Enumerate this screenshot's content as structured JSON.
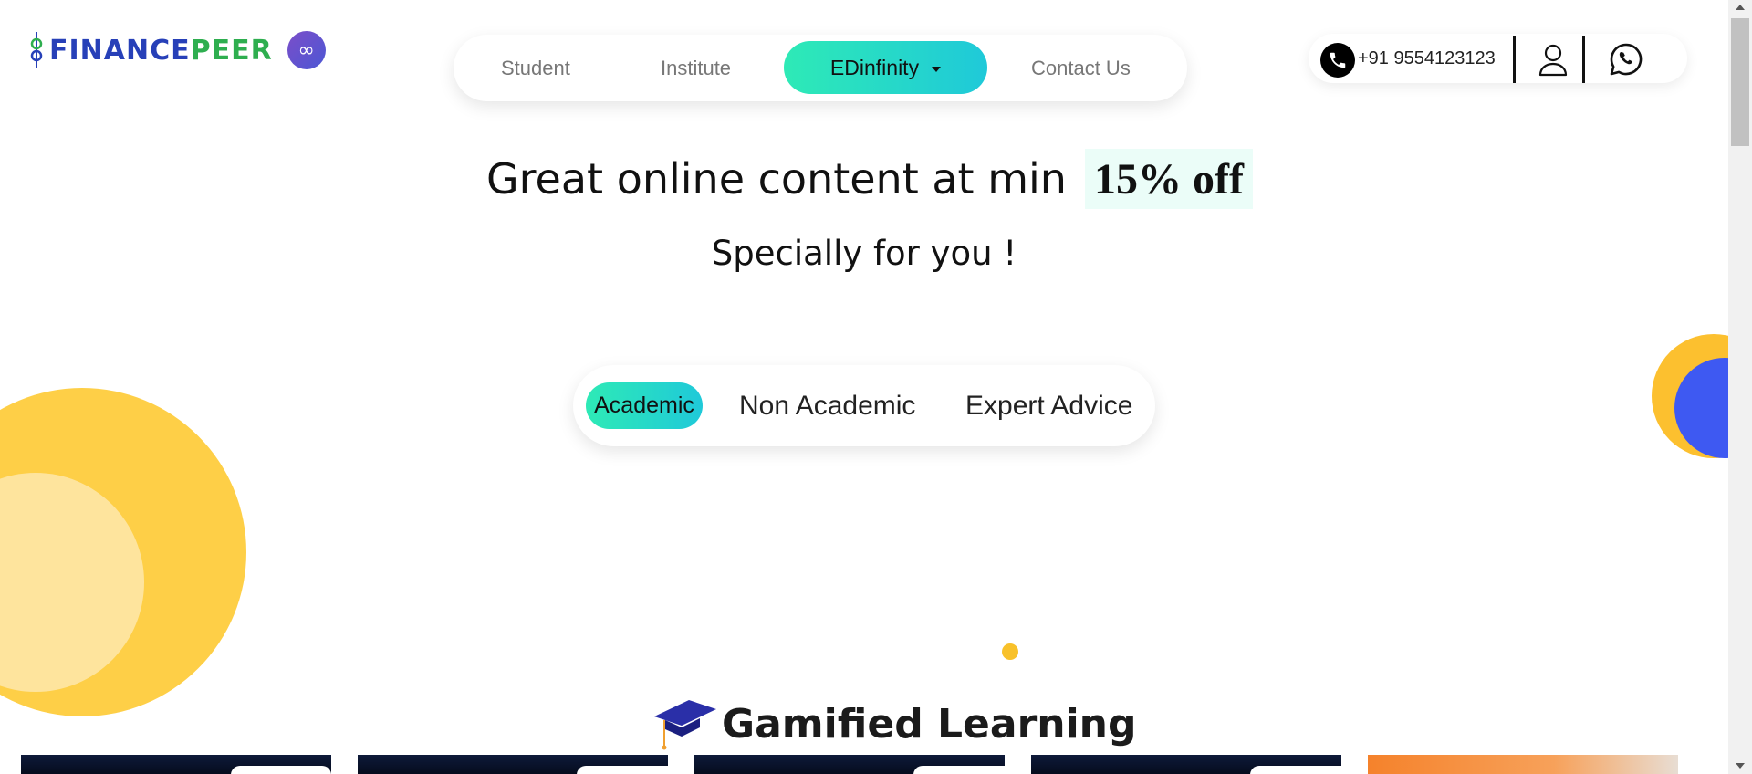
{
  "brand": {
    "name_part1": "FINANCE",
    "name_part2": "PEER",
    "badge_icon": "infinity-icon",
    "colors": {
      "primary": "#2740b8",
      "secondary": "#2eae4f",
      "accent": "#2eeab6"
    }
  },
  "nav": {
    "items": [
      {
        "label": "Student"
      },
      {
        "label": "Institute"
      },
      {
        "label": "EDinfinity"
      },
      {
        "label": "Contact Us"
      }
    ],
    "active": "EDinfinity"
  },
  "contact": {
    "phone": "+91 9554123123",
    "icons": [
      "phone-icon",
      "user-icon",
      "whatsapp-icon"
    ]
  },
  "hero": {
    "headline": "Great online content at min",
    "highlight": "15% off",
    "subhead": "Specially for you !"
  },
  "tabs": {
    "items": [
      {
        "label": "Academic"
      },
      {
        "label": "Non Academic"
      },
      {
        "label": "Expert Advice"
      }
    ],
    "active": "Academic"
  },
  "section": {
    "title": "Gamified Learning",
    "icon": "graduation-cap-icon"
  }
}
